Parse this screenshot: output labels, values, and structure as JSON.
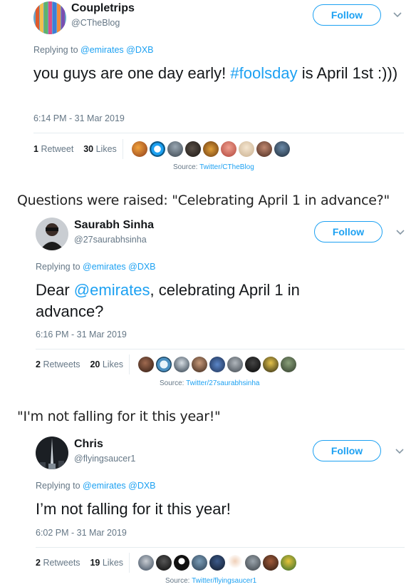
{
  "tweets": [
    {
      "display_name": "Coupletrips",
      "handle": "@CTheBlog",
      "follow_label": "Follow",
      "replying_prefix": "Replying to",
      "replying_to": "@emirates @DXB",
      "text_before": "you guys are one day early! ",
      "hashtag": "#foolsday",
      "text_after": " is April 1st :)))",
      "timestamp": "6:14 PM - 31 Mar 2019",
      "retweets_count": "1",
      "retweets_label": "Retweet",
      "likes_count": "30",
      "likes_label": "Likes",
      "source_label": "Source:",
      "source_link": "Twitter/CTheBlog"
    },
    {
      "display_name": "Saurabh Sinha",
      "handle": "@27saurabhsinha",
      "follow_label": "Follow",
      "replying_prefix": "Replying to",
      "replying_to": "@emirates @DXB",
      "text_before": "Dear ",
      "mention": "@emirates",
      "text_after": ", celebrating April 1 in advance?",
      "timestamp": "6:16 PM - 31 Mar 2019",
      "retweets_count": "2",
      "retweets_label": "Retweets",
      "likes_count": "20",
      "likes_label": "Likes",
      "source_label": "Source:",
      "source_link": "Twitter/27saurabhsinha"
    },
    {
      "display_name": "Chris",
      "handle": "@flyingsaucer1",
      "follow_label": "Follow",
      "replying_prefix": "Replying to",
      "replying_to": "@emirates @DXB",
      "text": "I’m not falling for it this year!",
      "timestamp": "6:02 PM - 31 Mar 2019",
      "retweets_count": "2",
      "retweets_label": "Retweets",
      "likes_count": "19",
      "likes_label": "Likes",
      "source_label": "Source:",
      "source_link": "Twitter/flyingsaucer1"
    }
  ],
  "captions": {
    "first": "Questions were raised: \"Celebrating April 1 in advance?\"",
    "second": "\"I'm not falling for it this year!\""
  },
  "colors": {
    "accent": "#1da1f2",
    "secondary_text": "#657786",
    "divider": "#e6ecf0"
  },
  "icons": [
    "caret-down-icon",
    "liker-avatar-icon"
  ]
}
